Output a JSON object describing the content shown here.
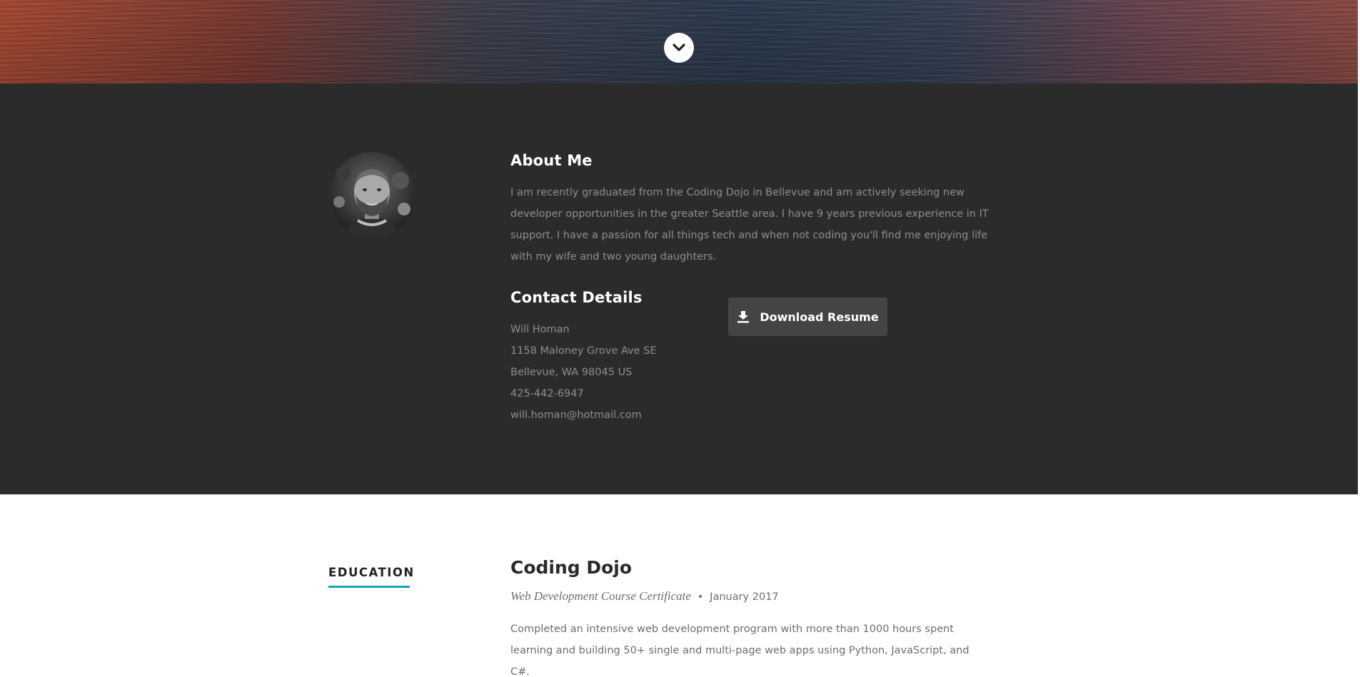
{
  "hero": {
    "scroll_icon": "chevron-down-icon"
  },
  "about": {
    "avatar_icon": "profile-photo",
    "title": "About Me",
    "text": "I am recently graduated from the Coding Dojo in Bellevue and am actively seeking new developer opportunities in the greater Seattle area. I have 9 years previous experience in IT support. I have a passion for all things tech and when not coding you'll find me enjoying life with my wife and two young daughters.",
    "contact_title": "Contact Details",
    "contact": {
      "name": "Will Homan",
      "street": "1158 Maloney Grove Ave SE",
      "city": "Bellevue, WA 98045 US",
      "phone": "425-442-6947",
      "email": "will.homan@hotmail.com"
    },
    "download_label": "Download Resume",
    "download_icon": "download-icon",
    "background_color": "#2b2b2b"
  },
  "education": {
    "section_label": "EDUCATION",
    "accent_color": "#11a8b5",
    "school": "Coding Dojo",
    "degree": "Web Development Course Certificate",
    "bullet": "•",
    "date": "January 2017",
    "description": "Completed an intensive web development program with more than 1000 hours spent learning and building 50+ single and multi-page web apps using Python, JavaScript, and C#."
  }
}
